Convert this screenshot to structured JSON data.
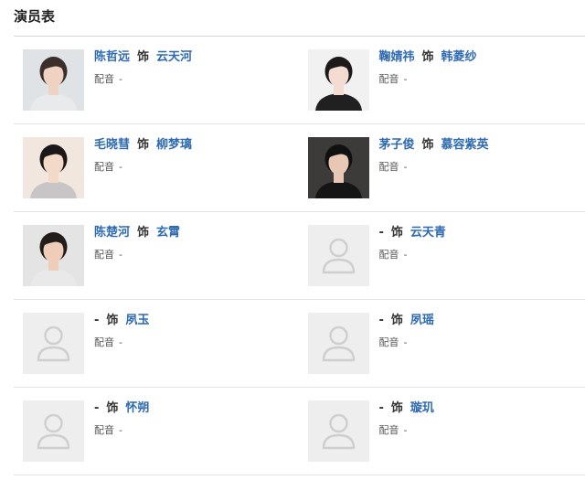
{
  "section": {
    "title": "演员表"
  },
  "cast": [
    {
      "actor": "陈哲远",
      "role_word": "饰",
      "role": "云天河",
      "dub_label": "配音",
      "dub_value": "-",
      "has_photo": true,
      "photo": {
        "bg": "#dfe3e6",
        "hair": "#3a2f2a",
        "skin": "#f0d2c2",
        "cloth": "#e8eaec"
      }
    },
    {
      "actor": "鞠婧祎",
      "role_word": "饰",
      "role": "韩菱纱",
      "dub_label": "配音",
      "dub_value": "-",
      "has_photo": true,
      "photo": {
        "bg": "#f1f1f1",
        "hair": "#1e1a1a",
        "skin": "#f4ddd0",
        "cloth": "#202020"
      }
    },
    {
      "actor": "毛晓彗",
      "role_word": "饰",
      "role": "柳梦璃",
      "dub_label": "配音",
      "dub_value": "-",
      "has_photo": true,
      "photo": {
        "bg": "#f2e7df",
        "hair": "#1c1818",
        "skin": "#f3d9c8",
        "cloth": "#c9c4c6"
      }
    },
    {
      "actor": "茅子俊",
      "role_word": "饰",
      "role": "慕容紫英",
      "dub_label": "配音",
      "dub_value": "-",
      "has_photo": true,
      "photo": {
        "bg": "#3d3a3a",
        "hair": "#111111",
        "skin": "#e8c7b4",
        "cloth": "#151515"
      }
    },
    {
      "actor": "陈楚河",
      "role_word": "饰",
      "role": "玄霄",
      "dub_label": "配音",
      "dub_value": "-",
      "has_photo": true,
      "photo": {
        "bg": "#e4e4e4",
        "hair": "#221c1a",
        "skin": "#efcdb9",
        "cloth": "#e9e9e9"
      }
    },
    {
      "actor": "-",
      "role_word": "饰",
      "role": "云天青",
      "dub_label": "配音",
      "dub_value": "-",
      "has_photo": false
    },
    {
      "actor": "-",
      "role_word": "饰",
      "role": "夙玉",
      "dub_label": "配音",
      "dub_value": "-",
      "has_photo": false
    },
    {
      "actor": "-",
      "role_word": "饰",
      "role": "夙瑶",
      "dub_label": "配音",
      "dub_value": "-",
      "has_photo": false
    },
    {
      "actor": "-",
      "role_word": "饰",
      "role": "怀朔",
      "dub_label": "配音",
      "dub_value": "-",
      "has_photo": false
    },
    {
      "actor": "-",
      "role_word": "饰",
      "role": "璇玑",
      "dub_label": "配音",
      "dub_value": "-",
      "has_photo": false
    }
  ]
}
